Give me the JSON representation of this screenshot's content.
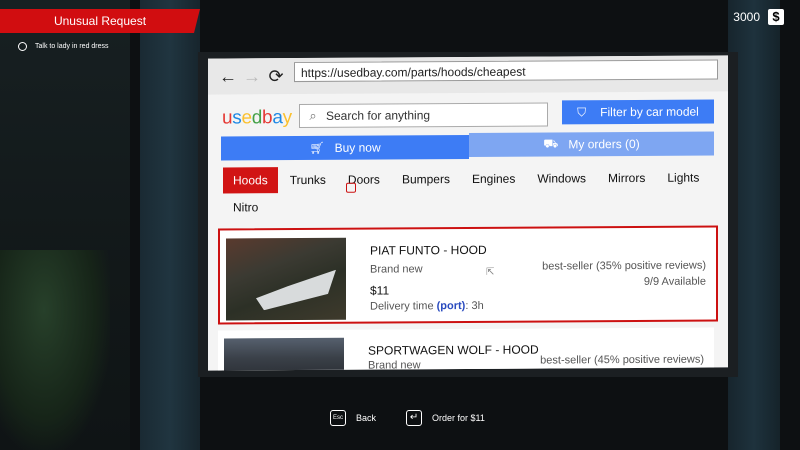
{
  "hud": {
    "quest_title": "Unusual Request",
    "quest_task": "Talk to lady in red dress",
    "money": "3000",
    "money_symbol": "$"
  },
  "browser": {
    "url": "https://usedbay.com/parts/hoods/cheapest",
    "back_icon": "←",
    "forward_icon": "→",
    "reload_icon": "⟳"
  },
  "site": {
    "logo": [
      "u",
      "s",
      "e",
      "d",
      "b",
      "a",
      "y"
    ],
    "logo_colors": [
      "#e53935",
      "#1e88e5",
      "#fbc02d",
      "#43a047",
      "#e53935",
      "#1e88e5",
      "#fbc02d"
    ],
    "search_placeholder": "Search for anything",
    "filter_label": "Filter by car model",
    "buy_label": "Buy now",
    "orders_label": "My orders (0)",
    "categories": [
      "Hoods",
      "Trunks",
      "Doors",
      "Bumpers",
      "Engines",
      "Windows",
      "Mirrors",
      "Lights"
    ],
    "categories_row2": "Nitro",
    "active_category": "Hoods"
  },
  "listings": [
    {
      "title": "PIAT FUNTO - HOOD",
      "condition": "Brand new",
      "price": "$11",
      "delivery_prefix": "Delivery time ",
      "delivery_port": "(port)",
      "delivery_time": ": 3h",
      "seller": "best-seller (35% positive reviews)",
      "available": "9/9 Available"
    },
    {
      "title": "SPORTWAGEN WOLF - HOOD",
      "condition": "Brand new",
      "seller": "best-seller (45% positive reviews)"
    }
  ],
  "hints": {
    "back_key": "Esc",
    "back_label": "Back",
    "order_key": "↵",
    "order_label": "Order for $11"
  }
}
